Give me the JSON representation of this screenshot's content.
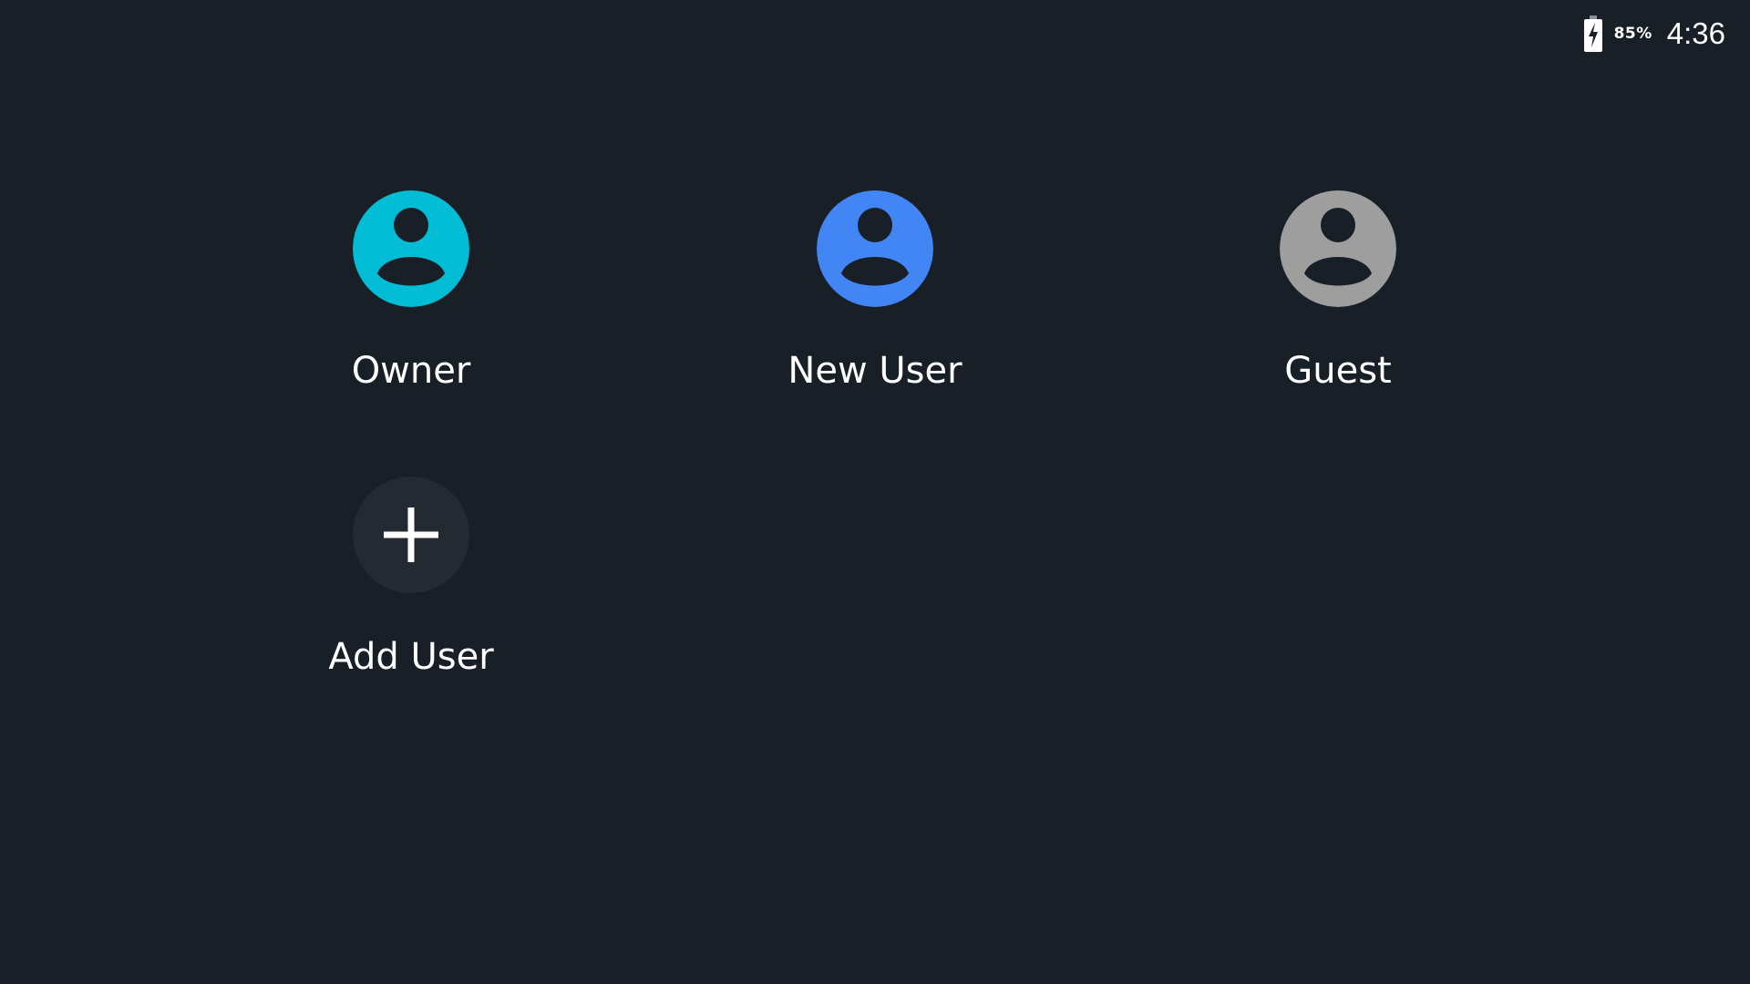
{
  "status_bar": {
    "battery_percent": "85%",
    "battery_icon": "battery-charging-icon",
    "time": "4:36"
  },
  "users": [
    {
      "label": "Owner",
      "avatar_color": "#00bcd4",
      "icon": "person-icon"
    },
    {
      "label": "New User",
      "avatar_color": "#4285f4",
      "icon": "person-icon"
    },
    {
      "label": "Guest",
      "avatar_color": "#9e9e9e",
      "icon": "person-icon"
    }
  ],
  "add_user": {
    "label": "Add User",
    "icon": "plus-icon",
    "circle_color": "#242a31"
  },
  "colors": {
    "background": "#181f27",
    "text": "#ffffff"
  }
}
